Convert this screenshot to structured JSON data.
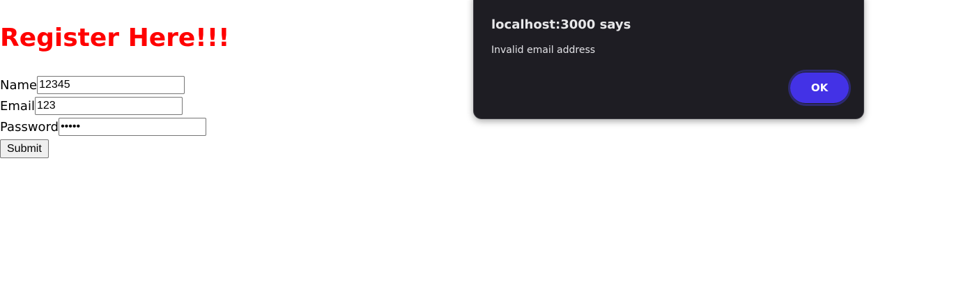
{
  "page": {
    "title": "Register Here!!!"
  },
  "form": {
    "name_label": "Name",
    "name_value": "12345",
    "email_label": "Email",
    "email_value": "123",
    "password_label": "Password",
    "password_value": "•••••",
    "submit_label": "Submit"
  },
  "alert": {
    "title": "localhost:3000 says",
    "message": "Invalid email address",
    "ok_label": "OK",
    "colors": {
      "background": "#1e1d23",
      "ok_button": "#4332e6"
    }
  },
  "colors": {
    "title": "#ff0000"
  }
}
